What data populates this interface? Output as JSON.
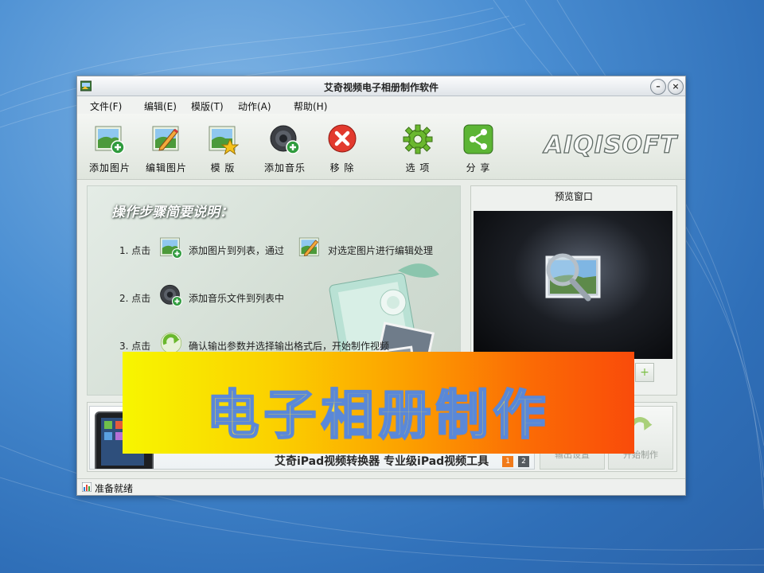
{
  "window": {
    "title": "艾奇视频电子相册制作软件",
    "minimize_label": "–",
    "close_label": "×"
  },
  "menu": [
    {
      "label": "文件(F)"
    },
    {
      "label": "编辑(E)"
    },
    {
      "label": "模版(T)"
    },
    {
      "label": "动作(A)"
    },
    {
      "label": "帮助(H)"
    }
  ],
  "toolbar": {
    "add_picture": "添加图片",
    "edit_picture": "编辑图片",
    "template": "模 版",
    "add_music": "添加音乐",
    "remove": "移 除",
    "options": "选 项",
    "share": "分 享",
    "brand": "AIQISOFT"
  },
  "instructions": {
    "title": "操作步骤简要说明：",
    "step1_prefix": "1. 点击",
    "step1_mid": "添加图片到列表，通过",
    "step1_suffix": "对选定图片进行编辑处理",
    "step2_prefix": "2. 点击",
    "step2_suffix": "添加音乐文件到列表中",
    "step3_prefix": "3. 点击",
    "step3_suffix": "确认输出参数并选择输出格式后，开始制作视频"
  },
  "preview": {
    "title": "预览窗口",
    "play_label": "+"
  },
  "ad": {
    "text": "艾奇iPad视频转换器 专业级iPad视频工具",
    "pages": [
      "1",
      "2"
    ]
  },
  "bottom_buttons": {
    "settings_label": "输出设置",
    "start_label": "开始制作"
  },
  "status": {
    "text": "准备就绪"
  },
  "overlay": {
    "text": "电子相册制作"
  }
}
